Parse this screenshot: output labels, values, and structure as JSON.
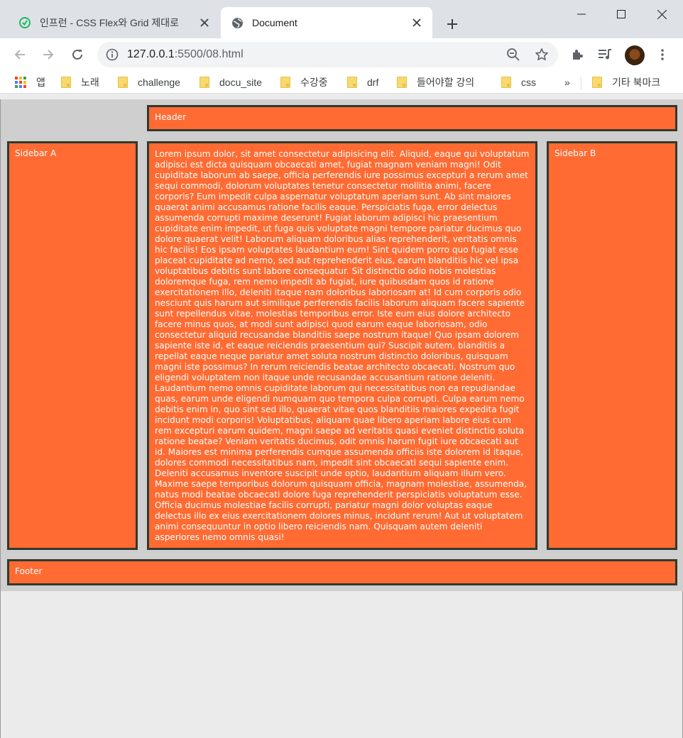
{
  "browser": {
    "tabs": [
      {
        "title": "인프런 - CSS Flex와 Grid 제대로",
        "active": false
      },
      {
        "title": "Document",
        "active": true
      }
    ],
    "url": {
      "host": "127.0.0.1",
      "path": ":5500/08.html"
    },
    "bookmarks": [
      {
        "label": "앱",
        "type": "apps"
      },
      {
        "label": "노래",
        "type": "folder"
      },
      {
        "label": "challenge",
        "type": "folder"
      },
      {
        "label": "docu_site",
        "type": "folder"
      },
      {
        "label": "수강중",
        "type": "folder"
      },
      {
        "label": "drf",
        "type": "folder"
      },
      {
        "label": "들어야할 강의",
        "type": "folder"
      },
      {
        "label": "css",
        "type": "folder"
      },
      {
        "label": "기타 북마크",
        "type": "folder"
      }
    ],
    "overflow_label": "»",
    "colors": {
      "tabstrip": "#dee1e6",
      "omnibox": "#f1f3f4"
    }
  },
  "page": {
    "header": "Header",
    "sidebar_a": "Sidebar A",
    "sidebar_b": "Sidebar B",
    "footer": "Footer",
    "content": "Lorem ipsum dolor, sit amet consectetur adipisicing elit. Aliquid, eaque qui voluptatum adipisci est dicta quisquam obcaecati amet, fugiat magnam veniam magni! Odit cupiditate laborum ab saepe, officia perferendis iure possimus excepturi a rerum amet sequi commodi, dolorum voluptates tenetur consectetur mollitia animi, facere corporis? Eum impedit culpa aspernatur voluptatum aperiam sunt. Ab sint maiores quaerat animi accusamus ratione facilis eaque. Perspiciatis fuga, error delectus assumenda corrupti maxime deserunt! Fugiat laborum adipisci hic praesentium cupiditate enim impedit, ut fuga quis voluptate magni tempore pariatur ducimus quo dolore quaerat velit! Laborum aliquam doloribus alias reprehenderit, veritatis omnis hic facilis! Eos ipsam voluptates laudantium eum! Sint quidem porro quo fugiat esse placeat cupiditate ad nemo, sed aut reprehenderit eius, earum blanditiis hic vel ipsa voluptatibus debitis sunt labore consequatur. Sit distinctio odio nobis molestias doloremque fuga, rem nemo impedit ab fugiat, iure quibusdam quos id ratione exercitationem illo, deleniti itaque nam doloribus laboriosam at! Id cum corporis odio nesciunt quis harum aut similique perferendis facilis laborum aliquam facere sapiente sunt repellendus vitae, molestias temporibus error. Iste eum eius dolore architecto facere minus quos, at modi sunt adipisci quod earum eaque laboriosam, odio consectetur aliquid recusandae blanditiis saepe nostrum itaque! Quo ipsam dolorem sapiente iste id, et eaque reiciendis praesentium qui? Suscipit autem, blanditiis a repellat eaque neque pariatur amet soluta nostrum distinctio doloribus, quisquam magni iste possimus? In rerum reiciendis beatae architecto obcaecati. Nostrum quo eligendi voluptatem non itaque unde recusandae accusantium ratione deleniti. Laudantium nemo omnis cupiditate laborum qui necessitatibus non ea repudiandae quas, earum unde eligendi numquam quo tempora culpa corrupti. Culpa earum nemo debitis enim in, quo sint sed illo, quaerat vitae quos blanditiis maiores expedita fugit incidunt modi corporis! Voluptatibus, aliquam quae libero aperiam labore eius cum rem excepturi earum quidem, magni saepe ad veritatis quasi eveniet distinctio soluta ratione beatae? Veniam veritatis ducimus, odit omnis harum fugit iure obcaecati aut id. Maiores est minima perferendis cumque assumenda officiis iste dolorem id itaque, dolores commodi necessitatibus nam, impedit sint obcaecati sequi sapiente enim. Deleniti accusamus inventore suscipit unde optio, laudantium aliquam illum vero. Maxime saepe temporibus dolorum quisquam officia, magnam molestiae, assumenda, natus modi beatae obcaecati dolore fuga reprehenderit perspiciatis voluptatum esse. Officia ducimus molestiae facilis corrupti, pariatur magni dolor voluptas eaque delectus illo ex eius exercitationem dolores minus, incidunt rerum! Aut ut voluptatem animi consequuntur in optio libero reiciendis nam. Quisquam autem deleniti asperiores nemo omnis quasi!",
    "colors": {
      "box_fill": "#ff6b32",
      "box_border": "#2f3a2f",
      "grid_bg": "#cfcfcf",
      "page_bg": "#ebebeb"
    }
  }
}
